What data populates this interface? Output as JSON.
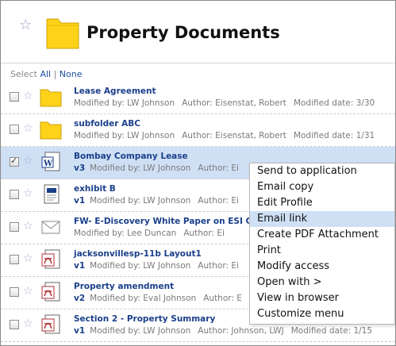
{
  "header": {
    "title": "Property Documents",
    "star_icon": "star-icon",
    "folder_icon": "folder-icon"
  },
  "select_bar": {
    "prefix": "Select",
    "all": "All",
    "separator": "|",
    "none": "None"
  },
  "rows": [
    {
      "name": "Lease Agreement",
      "icon": "folder-icon",
      "version": "",
      "meta": [
        "Modified by: LW Johnson",
        "Author: Eisenstat, Robert",
        "Modified date: 3/30"
      ],
      "selected": false
    },
    {
      "name": "subfolder ABC",
      "icon": "folder-icon",
      "version": "",
      "meta": [
        "Modified by: LW Johnson",
        "Author: Eisenstat, Robert",
        "Modified date: 1/31"
      ],
      "selected": false
    },
    {
      "name": "Bombay Company Lease",
      "icon": "word-document-icon",
      "version": "v3",
      "meta": [
        "Modified by: LW Johnson",
        "Author: Ei"
      ],
      "selected": true
    },
    {
      "name": "exhibit B",
      "icon": "document-icon",
      "version": "v1",
      "meta": [
        "Modified by: LW Johnson",
        "Author: Ei"
      ],
      "selected": false
    },
    {
      "name": "FW- E-Discovery White Paper on ESI C",
      "icon": "email-icon",
      "version": "",
      "meta": [
        "Modified by: Lee Duncan",
        "Author: Ei"
      ],
      "selected": false
    },
    {
      "name": "jacksonvillesp-11b Layout1",
      "icon": "pdf-icon",
      "version": "v1",
      "meta": [
        "Modified by: LW Johnson",
        "Author: Ei"
      ],
      "selected": false
    },
    {
      "name": "Property amendment",
      "icon": "pdf-icon",
      "version": "v2",
      "meta": [
        "Modified by: Eval Johnson",
        "Author: E"
      ],
      "selected": false
    },
    {
      "name": "Section 2 - Property Summary",
      "icon": "pdf-icon",
      "version": "v1",
      "meta": [
        "Modified by: LW Johnson",
        "Author: Johnson, LWJ",
        "Modified date: 1/15"
      ],
      "selected": false
    }
  ],
  "context_menu": {
    "items": [
      "Send to application",
      "Email copy",
      "Edit Profile",
      "Email link",
      "Create PDF Attachment",
      "Print",
      "Modify access",
      "Open with >",
      "View in browser",
      "Customize menu"
    ],
    "highlighted": "Email link"
  },
  "colors": {
    "link": "#1a3f8a",
    "selection": "#cfe0f5",
    "folder": "#ffd21a"
  }
}
